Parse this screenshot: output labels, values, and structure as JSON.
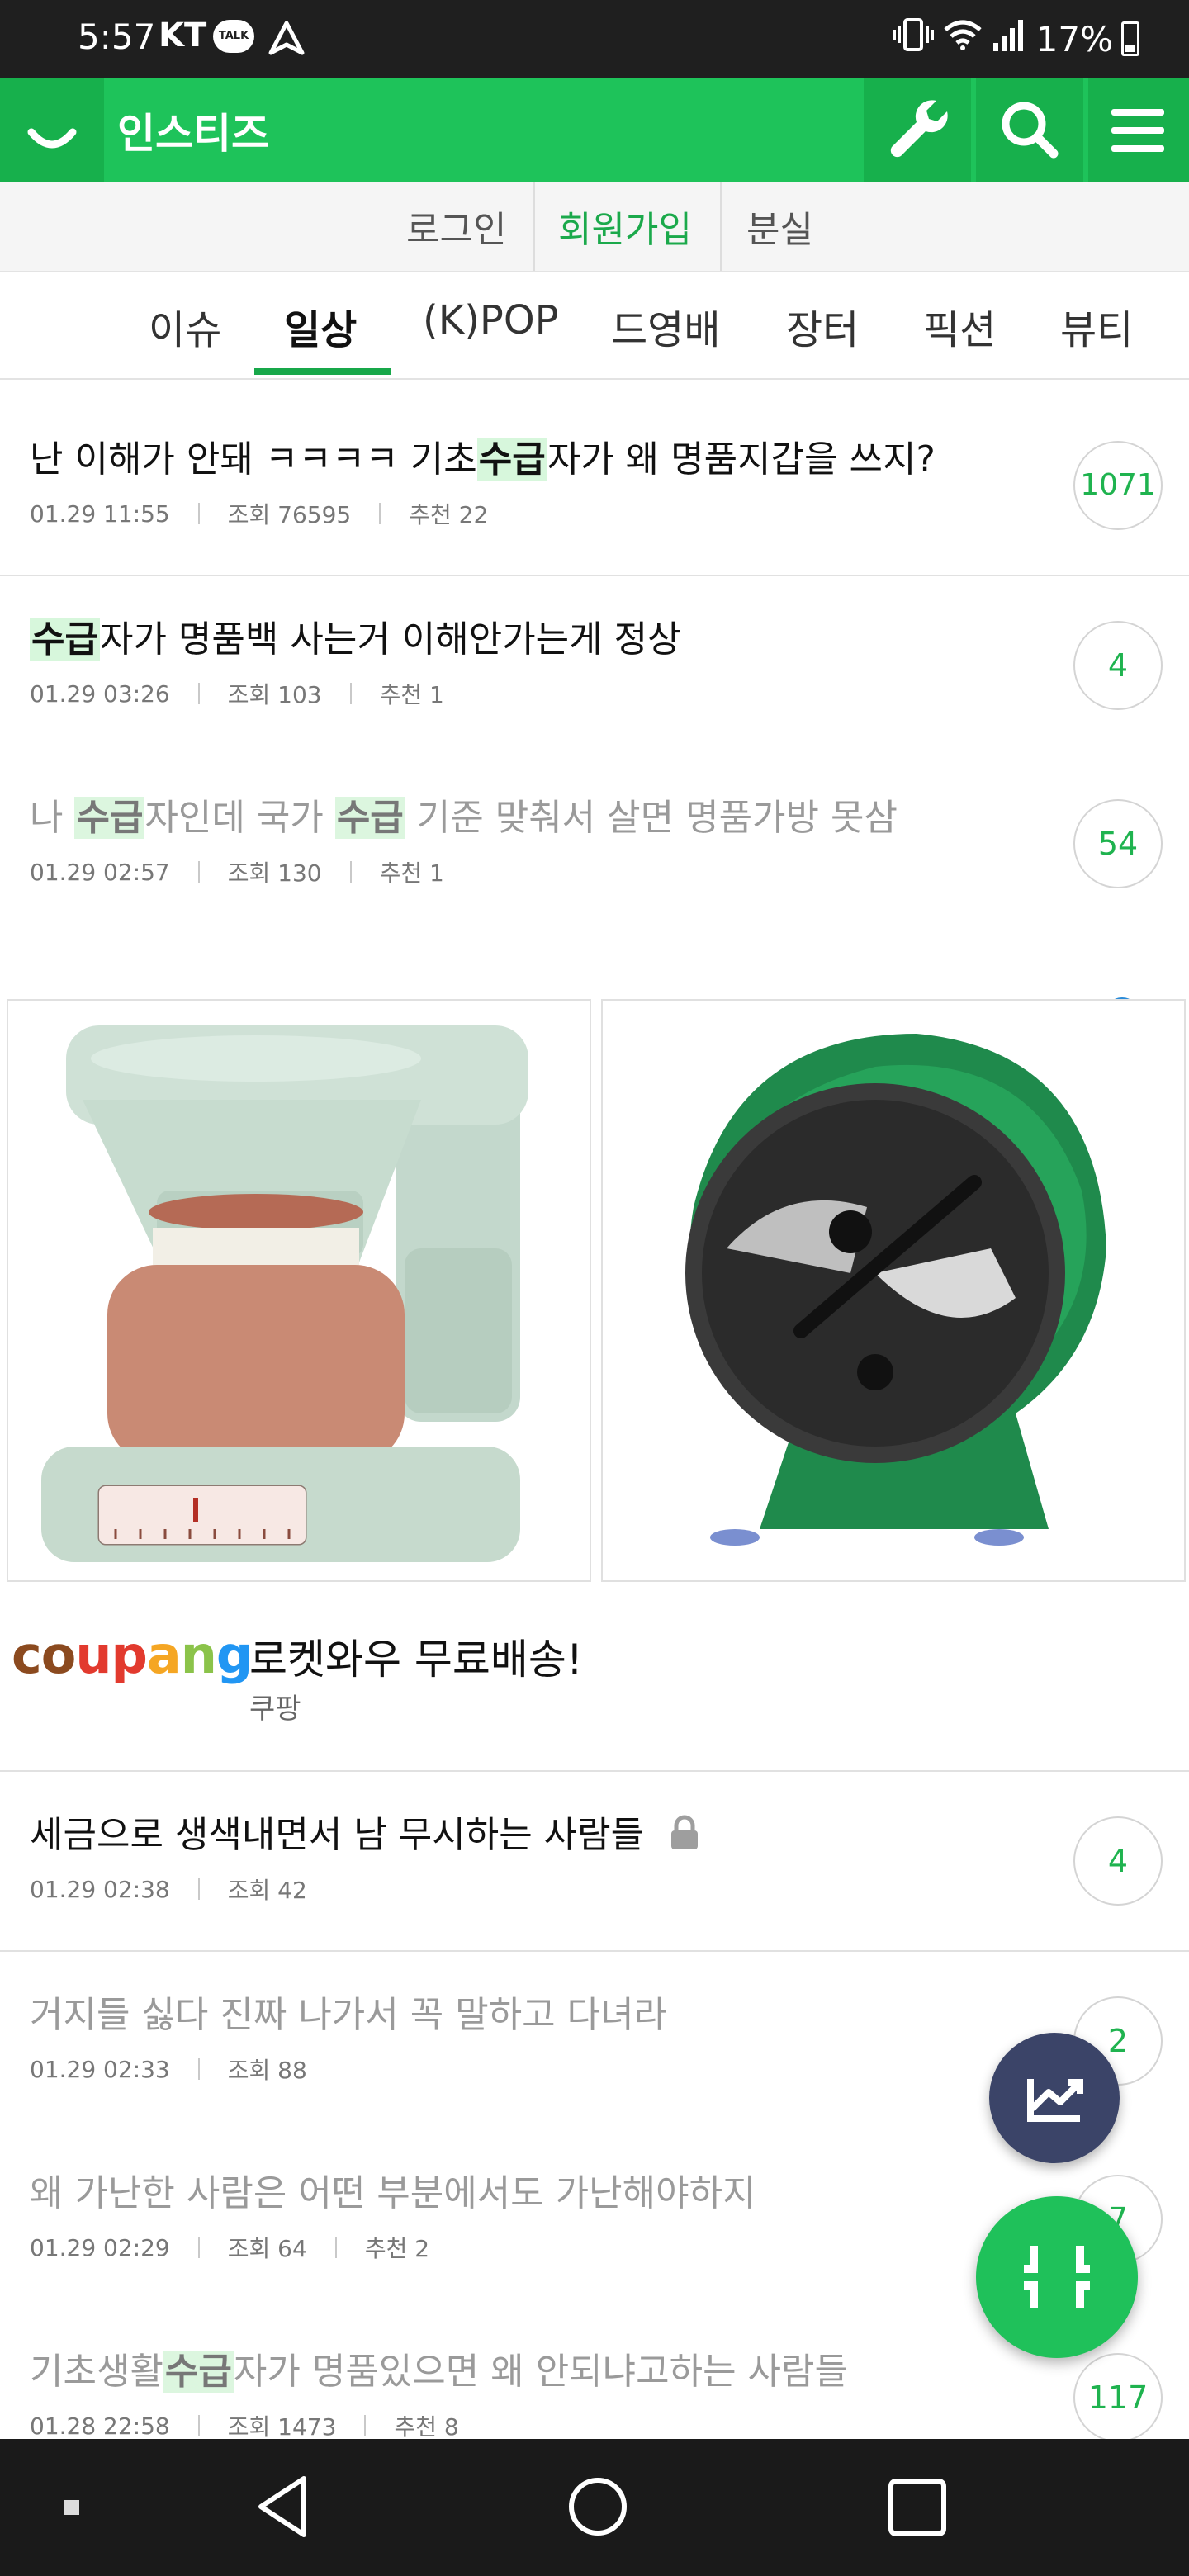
{
  "status_bar": {
    "time": "5:57",
    "carrier": "KT",
    "talk_badge": "TALK",
    "battery": "17%"
  },
  "header": {
    "title": "인스티즈",
    "icons": [
      "wrench-icon",
      "search-icon",
      "menu-icon"
    ],
    "accent_color": "#1ec35a"
  },
  "auth": {
    "login": "로그인",
    "signup": "회원가입",
    "lost": "분실"
  },
  "tabs": [
    {
      "label": "이슈"
    },
    {
      "label": "일상",
      "active": true
    },
    {
      "label": "(K)POP"
    },
    {
      "label": "드영배"
    },
    {
      "label": "장터"
    },
    {
      "label": "픽션"
    },
    {
      "label": "뷰티"
    }
  ],
  "posts": [
    {
      "title_parts": [
        "난 이해가 안돼 ㅋㅋㅋㅋ 기초",
        "수급",
        "자가 왜 명품지갑을 쓰지?"
      ],
      "date": "01.29 11:55",
      "views": "조회 76595",
      "recs": "추천 22",
      "count": "1071"
    },
    {
      "title_parts": [
        "",
        "수급",
        "자가 명품백 사는거 이해안가는게 정상"
      ],
      "date": "01.29 03:26",
      "views": "조회 103",
      "recs": "추천 1",
      "count": "4"
    },
    {
      "title_parts": [
        "나 ",
        "수급",
        "자인데 국가 ",
        "수급",
        " 기준 맞춰서 살면 명품가방 못삼"
      ],
      "date": "01.29 02:57",
      "views": "조회 130",
      "recs": "추천 1",
      "count": "54"
    },
    {
      "title": "세금으로 생색내면서 남 무시하는 사람들",
      "date": "01.29 02:38",
      "views": "조회 42",
      "count": "4"
    },
    {
      "title": "거지들 싫다 진짜 나가서 꼭 말하고 다녀라",
      "date": "01.29 02:33",
      "views": "조회 88",
      "count": "2"
    },
    {
      "title": "왜 가난한 사람은 어떤 부분에서도 가난해야하지",
      "date": "01.29 02:29",
      "views": "조회 64",
      "recs": "추천 2",
      "count": "7"
    },
    {
      "title_parts": [
        "기초생활",
        "수급",
        "자가 명품있으면 왜 안되냐고하는 사람들"
      ],
      "date": "01.28 22:58",
      "views": "조회 1473",
      "recs": "추천 8",
      "count": "117"
    }
  ],
  "ad": {
    "brand": "coupang",
    "title": "로켓와우 무료배송!",
    "subtitle": "쿠팡"
  }
}
